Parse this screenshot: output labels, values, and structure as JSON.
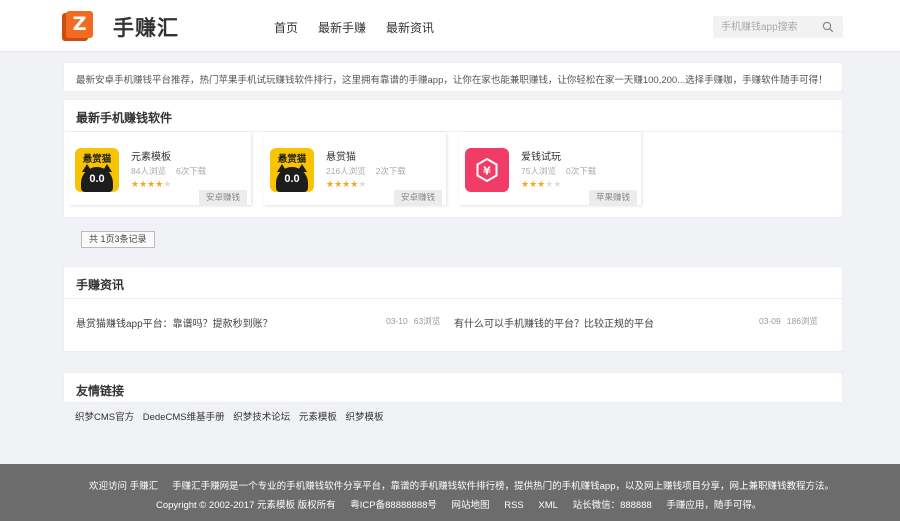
{
  "site": {
    "logo_letter": "Z",
    "brand": "手赚汇",
    "accent_color": "#f26b21"
  },
  "nav": {
    "items": [
      {
        "label": "首页"
      },
      {
        "label": "最新手赚"
      },
      {
        "label": "最新资讯"
      }
    ]
  },
  "search": {
    "placeholder": "手机赚钱app搜索",
    "icon": "search-icon"
  },
  "intro": {
    "text": "最新安卓手机赚钱平台推荐，热门苹果手机试玩赚钱软件排行，这里拥有靠谱的手赚app，让你在家也能兼职赚钱，让你轻松在家一天赚100,200...选择手赚咖，手赚软件随手可得！"
  },
  "apps_section": {
    "title": "最新手机赚钱软件",
    "apps": [
      {
        "name": "元素模板",
        "views": "84人浏览",
        "downloads": "6次下载",
        "rating": 4,
        "tag": "安卓赚钱",
        "icon": "cat-face-icon",
        "icon_text": "悬赏猫",
        "icon_face": "0.0"
      },
      {
        "name": "悬赏猫",
        "views": "216人浏览",
        "downloads": "2次下载",
        "rating": 4,
        "tag": "安卓赚钱",
        "icon": "cat-face-icon",
        "icon_text": "悬赏猫",
        "icon_face": "0.0"
      },
      {
        "name": "爱钱试玩",
        "views": "75人浏览",
        "downloads": "0次下载",
        "rating": 3,
        "tag": "苹果赚钱",
        "icon": "yen-hexagon-icon",
        "icon_color": "#f03c66"
      }
    ],
    "pager": "共 1页3条记录"
  },
  "news_section": {
    "title": "手赚资讯",
    "items": [
      {
        "title": "悬赏猫赚钱app平台：靠谱吗？提款秒到账？",
        "date": "03-10",
        "views": "63浏览"
      },
      {
        "title": "有什么可以手机赚钱的平台？比较正规的平台",
        "date": "03-09",
        "views": "186浏览"
      }
    ]
  },
  "links_section": {
    "title": "友情链接",
    "links": [
      "织梦CMS官方",
      "DedeCMS维基手册",
      "织梦技术论坛",
      "元素模板",
      "织梦模板"
    ]
  },
  "footer": {
    "welcome": "欢迎访问 手赚汇",
    "description": "手赚汇手赚网是一个专业的手机赚钱软件分享平台，靠谱的手机赚钱软件排行榜，提供热门的手机赚钱app，以及网上赚钱项目分享，网上兼职赚钱教程方法。",
    "copyright": "Copyright © 2002-2017 元素模板 版权所有",
    "icp": "粤ICP备88888888号",
    "sitemap": "网站地图",
    "rss": "RSS",
    "xml": "XML",
    "wechat": "站长微信：888888",
    "slogan": "手赚应用，随手可得。"
  }
}
